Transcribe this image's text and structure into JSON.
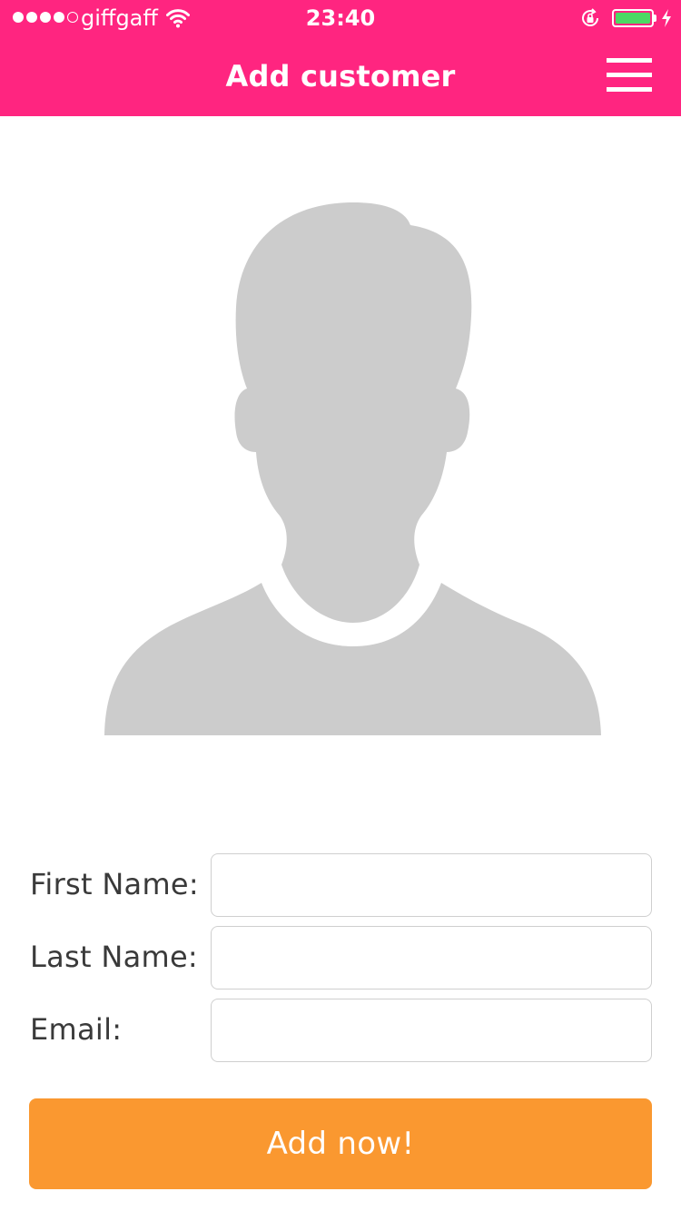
{
  "status_bar": {
    "signal_bars_filled": 4,
    "signal_bars_total": 5,
    "carrier": "giffgaff",
    "wifi_icon": "wifi-icon",
    "time": "23:40",
    "orientation_lock_icon": "orientation-lock-icon",
    "battery_level": 1.0,
    "battery_color": "#4cd964",
    "charging_icon": "charging-bolt-icon"
  },
  "nav": {
    "title": "Add customer",
    "menu_icon": "hamburger-menu-icon",
    "background_color": "#ff2580"
  },
  "avatar": {
    "icon": "person-silhouette-icon",
    "color": "#cccccc"
  },
  "form": {
    "fields": [
      {
        "label": "First Name:",
        "value": "",
        "placeholder": ""
      },
      {
        "label": "Last Name:",
        "value": "",
        "placeholder": ""
      },
      {
        "label": "Email:",
        "value": "",
        "placeholder": ""
      }
    ],
    "submit_label": "Add now!",
    "submit_color": "#fa9830"
  }
}
